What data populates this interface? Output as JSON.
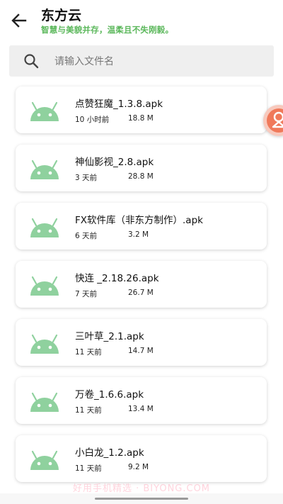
{
  "header": {
    "title": "东方云",
    "subtitle": "智慧与美貌并存，温柔且不失刚毅。"
  },
  "search": {
    "placeholder": "请输入文件名",
    "value": ""
  },
  "files": [
    {
      "name": "点赞狂魔_1.3.8.apk",
      "time": "10 小时前",
      "size": "18.8 M"
    },
    {
      "name": "神仙影视_2.8.apk",
      "time": "3 天前",
      "size": "28.8 M"
    },
    {
      "name": "FX软件库（非东方制作）.apk",
      "time": "6 天前",
      "size": "3.2 M"
    },
    {
      "name": "快连 _2.18.26.apk",
      "time": "7 天前",
      "size": "26.7 M"
    },
    {
      "name": "三叶草_2.1.apk",
      "time": "11 天前",
      "size": "14.7 M"
    },
    {
      "name": "万卷_1.6.6.apk",
      "time": "11 天前",
      "size": "13.4 M"
    },
    {
      "name": "小白龙_1.2.apk",
      "time": "11 天前",
      "size": "9.2 M"
    }
  ],
  "watermark": "好用手机精选 · BIYONG.COM",
  "icons": {
    "back": "arrow-left-icon",
    "search": "search-icon",
    "file": "android-icon",
    "float": "floating-ball-icon"
  },
  "colors": {
    "accent_green": "#5cb85c",
    "android_green": "#8fd19e",
    "float_orange": "#f0795a"
  }
}
